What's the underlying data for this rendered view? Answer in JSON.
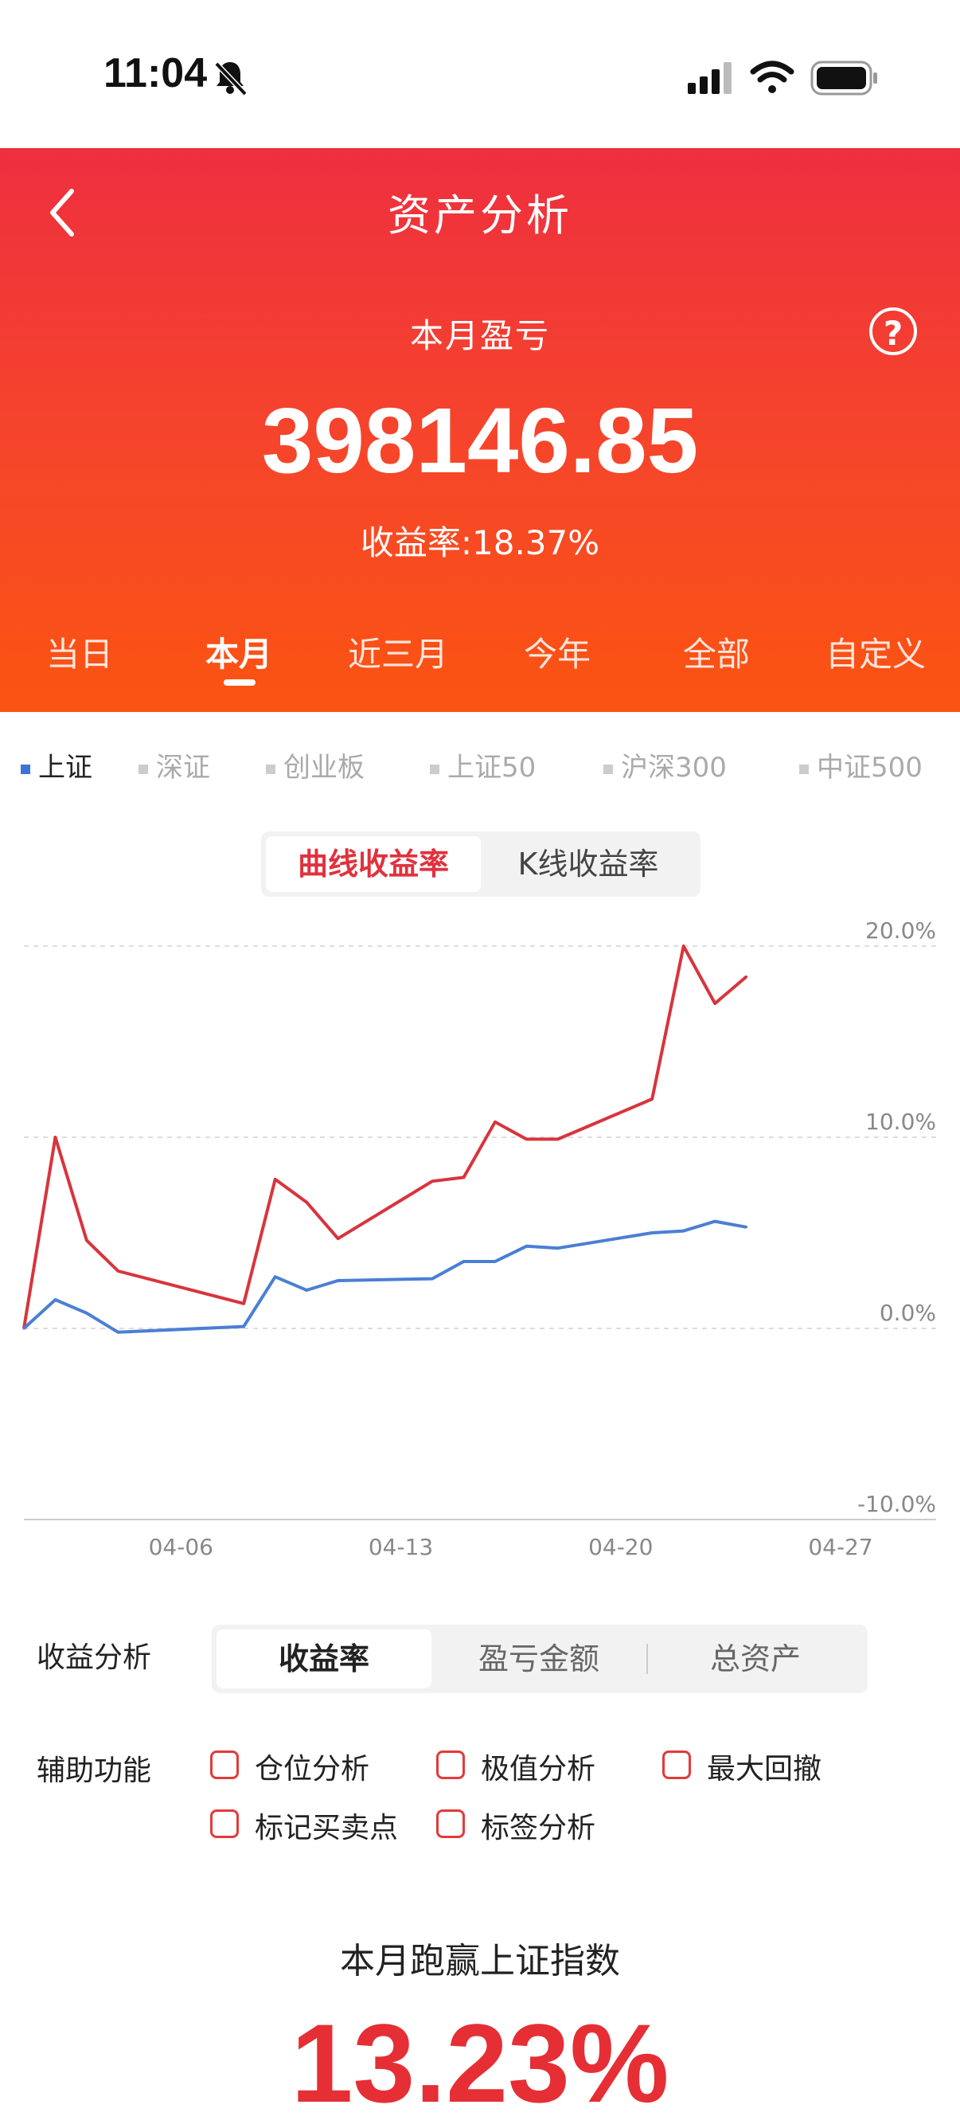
{
  "status_bar": {
    "time": "11:04"
  },
  "header": {
    "title": "资产分析",
    "month_label": "本月盈亏",
    "profit_loss": "398146.85",
    "return_rate": "收益率:18.37%",
    "help_symbol": "?"
  },
  "period_tabs": [
    "当日",
    "本月",
    "近三月",
    "今年",
    "全部",
    "自定义"
  ],
  "period_active": "本月",
  "index_tabs": [
    "上证",
    "深证",
    "创业板",
    "上证50",
    "沪深300",
    "中证500"
  ],
  "index_active": "上证",
  "chart_toggle": {
    "curve": "曲线收益率",
    "kline": "K线收益率",
    "active": "曲线收益率"
  },
  "chart_data": {
    "type": "line",
    "y_ticks": [
      "20.0%",
      "10.0%",
      "0.0%",
      "-10.0%"
    ],
    "ylim": [
      -10,
      20
    ],
    "x_ticks": [
      "04-06",
      "04-13",
      "04-20",
      "04-27"
    ],
    "x_range_days": [
      "04-01",
      "04-27"
    ],
    "grid": true,
    "series": [
      {
        "color": "#d8343d",
        "x": [
          "04-01",
          "04-02",
          "04-03",
          "04-04",
          "04-08",
          "04-09",
          "04-10",
          "04-11",
          "04-14",
          "04-15",
          "04-16",
          "04-17",
          "04-18",
          "04-21",
          "04-22",
          "04-23",
          "04-24"
        ],
        "values": [
          0.0,
          10.0,
          4.6,
          3.0,
          1.3,
          7.8,
          6.6,
          4.7,
          7.7,
          7.9,
          10.8,
          9.9,
          9.9,
          12.0,
          20.0,
          17.0,
          18.4
        ]
      },
      {
        "color": "#4a7fd4",
        "x": [
          "04-01",
          "04-02",
          "04-03",
          "04-04",
          "04-08",
          "04-09",
          "04-10",
          "04-11",
          "04-14",
          "04-15",
          "04-16",
          "04-17",
          "04-18",
          "04-21",
          "04-22",
          "04-23",
          "04-24"
        ],
        "values": [
          0.0,
          1.5,
          0.8,
          -0.2,
          0.1,
          2.7,
          2.0,
          2.5,
          2.6,
          3.5,
          3.5,
          4.3,
          4.2,
          5.0,
          5.1,
          5.6,
          5.3
        ]
      }
    ]
  },
  "analysis": {
    "label": "收益分析",
    "options": [
      "收益率",
      "盈亏金额",
      "总资产"
    ],
    "active": "收益率"
  },
  "aux": {
    "label": "辅助功能",
    "options": [
      "仓位分析",
      "极值分析",
      "最大回撤",
      "标记买卖点",
      "标签分析"
    ]
  },
  "beat": {
    "label": "本月跑赢上证指数",
    "value": "13.23%"
  }
}
